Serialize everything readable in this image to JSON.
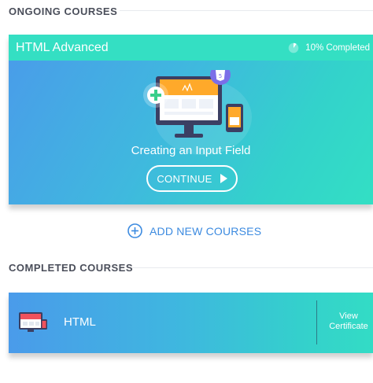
{
  "ongoing": {
    "title": "ONGOING COURSES",
    "course": {
      "name": "HTML Advanced",
      "progress_text": "10% Completed",
      "progress": 0.1,
      "lesson": "Creating an Input Field",
      "continue_label": "CONTINUE"
    }
  },
  "add_courses_label": "ADD NEW COURSES",
  "completed": {
    "title": "COMPLETED COURSES",
    "course": {
      "name": "HTML",
      "view_certificate_label": "View Certificate"
    }
  },
  "colors": {
    "accent_teal": "#34dfc3",
    "accent_blue": "#3d8be0",
    "gradient_start": "#4a9bea",
    "gradient_end": "#33dfc4"
  },
  "icons": [
    "progress-ring-icon",
    "play-icon",
    "plus-circle-icon",
    "course-illustration",
    "html5-badge-icon"
  ]
}
